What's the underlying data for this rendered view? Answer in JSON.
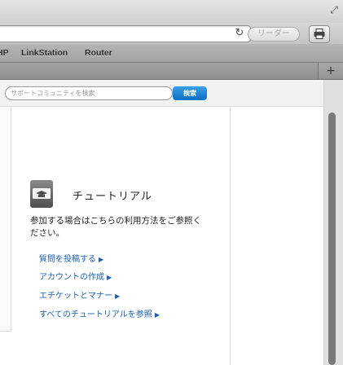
{
  "browser": {
    "reader_label": "リーダー",
    "bookmarks": [
      "HP",
      "LinkStation",
      "Router"
    ]
  },
  "search": {
    "placeholder": "サポートコミュニティを検索",
    "button_label": "検索"
  },
  "tutorial": {
    "title": "チュートリアル",
    "description": "参加する場合はこちらの利用方法をご参照ください。",
    "links": [
      "質問を投稿する",
      "アカウントの作成",
      "エチケットとマナー",
      "すべてのチュートリアルを参照"
    ]
  },
  "colors": {
    "link": "#1a5fb4",
    "search_button": "#0a6ec4"
  }
}
